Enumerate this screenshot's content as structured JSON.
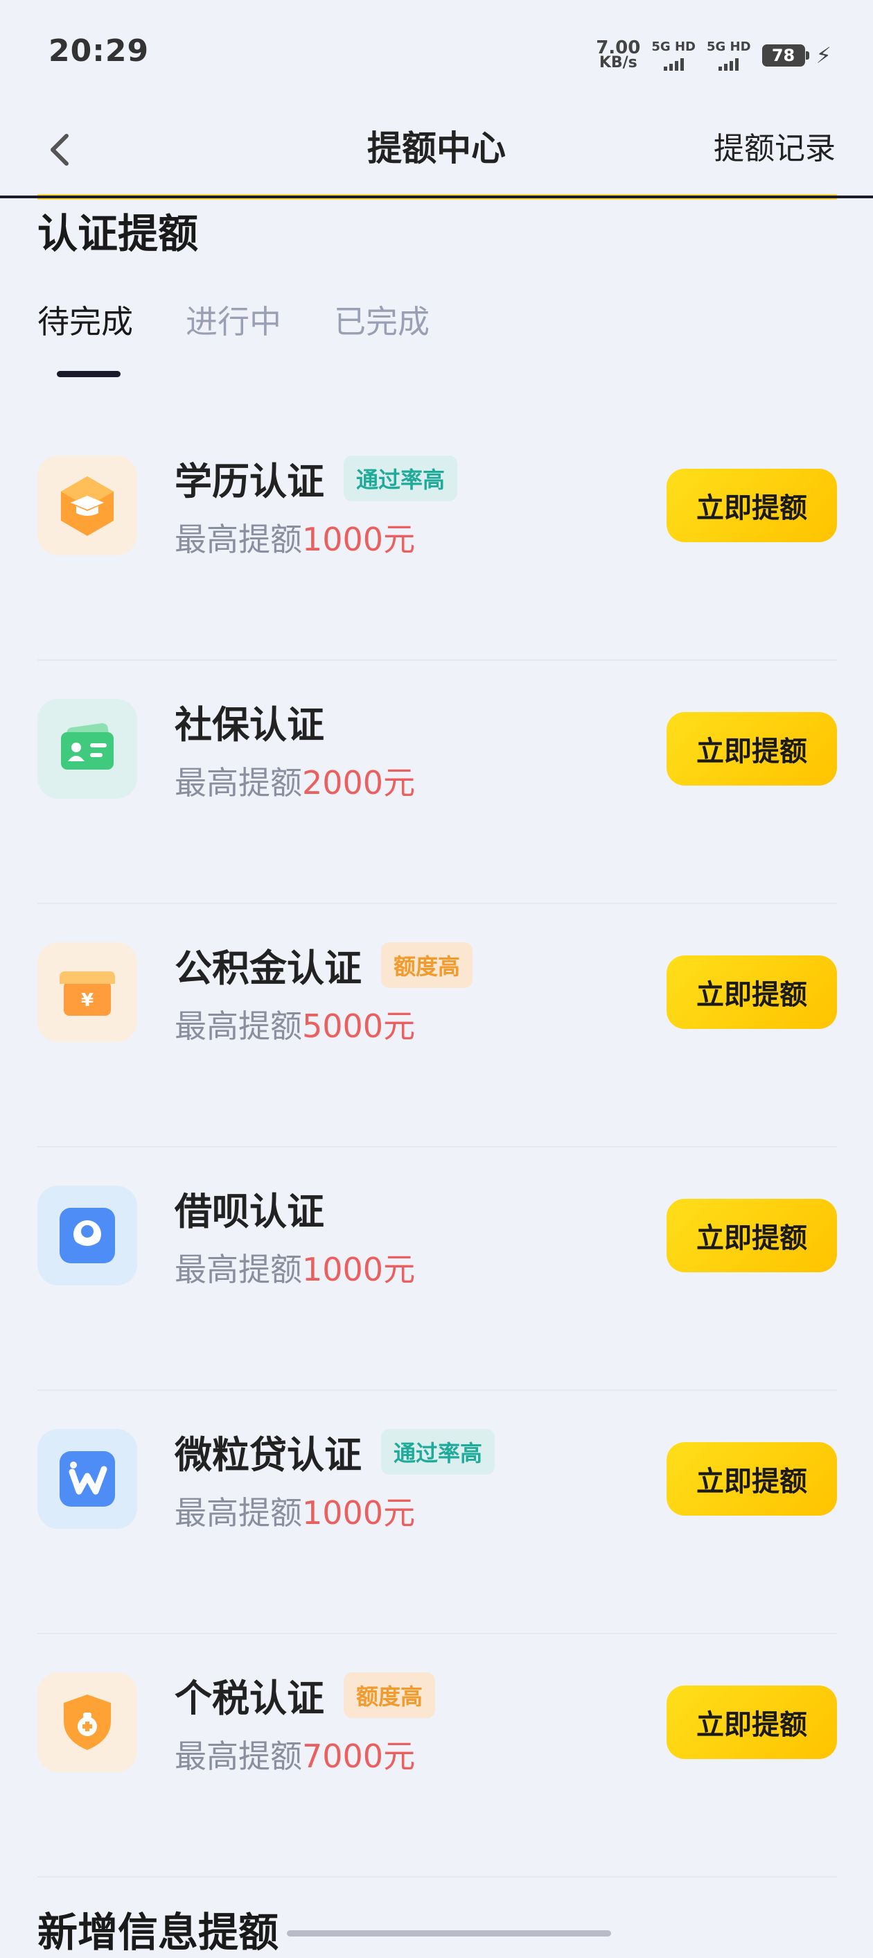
{
  "status": {
    "time": "20:29",
    "speed_value": "7.00",
    "speed_unit": "KB/s",
    "sim1": "5G HD",
    "sim2": "5G HD",
    "battery": "78"
  },
  "header": {
    "title": "提额中心",
    "record": "提额记录"
  },
  "section_title": "认证提额",
  "tabs": [
    {
      "label": "待完成",
      "active": true
    },
    {
      "label": "进行中",
      "active": false
    },
    {
      "label": "已完成",
      "active": false
    }
  ],
  "items": [
    {
      "name": "学历认证",
      "badge": "通过率高",
      "badge_style": "teal",
      "desc_prefix": "最高提额",
      "amount": "1000元",
      "action": "立即提额",
      "icon": "graduation-cap-icon",
      "icon_bg": "#fbeede"
    },
    {
      "name": "社保认证",
      "badge": "",
      "badge_style": "",
      "desc_prefix": "最高提额",
      "amount": "2000元",
      "action": "立即提额",
      "icon": "id-card-icon",
      "icon_bg": "#dff1ef"
    },
    {
      "name": "公积金认证",
      "badge": "额度高",
      "badge_style": "orange",
      "desc_prefix": "最高提额",
      "amount": "5000元",
      "action": "立即提额",
      "icon": "yuan-box-icon",
      "icon_bg": "#fbeede"
    },
    {
      "name": "借呗认证",
      "badge": "",
      "badge_style": "",
      "desc_prefix": "最高提额",
      "amount": "1000元",
      "action": "立即提额",
      "icon": "jiebei-icon",
      "icon_bg": "#dcecfb"
    },
    {
      "name": "微粒贷认证",
      "badge": "通过率高",
      "badge_style": "teal",
      "desc_prefix": "最高提额",
      "amount": "1000元",
      "action": "立即提额",
      "icon": "weilidai-icon",
      "icon_bg": "#dcecfb"
    },
    {
      "name": "个税认证",
      "badge": "额度高",
      "badge_style": "orange",
      "desc_prefix": "最高提额",
      "amount": "7000元",
      "action": "立即提额",
      "icon": "tax-shield-icon",
      "icon_bg": "#fbeede"
    }
  ],
  "section2_title": "新增信息提额",
  "colors": {
    "accent_yellow": "#ffd000",
    "amount_red": "#ec5f5f",
    "teal_badge": "#1faa9a",
    "orange_badge": "#f29b2c"
  }
}
